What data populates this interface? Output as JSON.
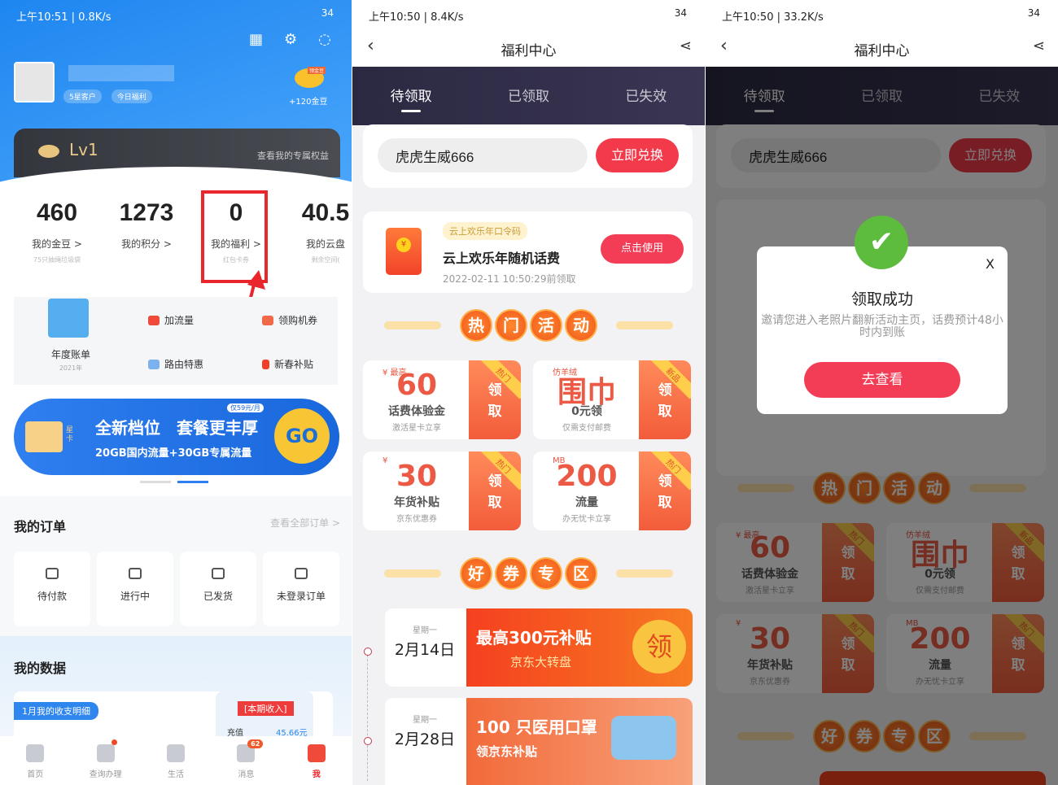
{
  "left": {
    "status": "上午10:51 | 0.8K/s",
    "battery": "34",
    "badges": [
      "5星客户",
      "今日福利"
    ],
    "beans_reward": "+120金豆",
    "beans_tag": "领金豆",
    "level": "Lv1",
    "level_link": "查看我的专属权益",
    "stats": [
      {
        "n": "460",
        "l": "我的金豆 >",
        "s": "75只抽绳垃圾袋"
      },
      {
        "n": "1273",
        "l": "我的积分 >",
        "s": ""
      },
      {
        "n": "0",
        "l": "我的福利 >",
        "s": "红包卡券"
      },
      {
        "n": "40.5",
        "l": "我的云盘",
        "s": "剩余空间("
      }
    ],
    "annual": {
      "label": "年度账单",
      "year": "2021年"
    },
    "quick": [
      "加流量",
      "领购机券",
      "路由特惠",
      "新春补贴"
    ],
    "banner": {
      "title": "全新档位　套餐更丰厚",
      "sub": "20GB国内流量+30GB专属流量",
      "tag": "仅59元/月",
      "go": "GO",
      "card": "星卡"
    },
    "orders": {
      "title": "我的订单",
      "link": "查看全部订单 >",
      "items": [
        "待付款",
        "进行中",
        "已发货",
        "未登录订单"
      ]
    },
    "data": {
      "title": "我的数据",
      "tag": "1月我的收支明细",
      "income": "[本期收入]",
      "row_label": "充值",
      "row_val": "45.66元"
    },
    "tabbar": [
      {
        "l": "首页"
      },
      {
        "l": "查询办理"
      },
      {
        "l": "生活"
      },
      {
        "l": "消息",
        "badge": "62"
      },
      {
        "l": "我"
      }
    ],
    "highlight_color": "#e8262b"
  },
  "mid": {
    "status": "上午10:50 | 8.4K/s",
    "battery": "34",
    "title": "福利中心",
    "tabs": [
      "待领取",
      "已领取",
      "已失效"
    ],
    "code_value": "虎虎生威666",
    "redeem": "立即兑换",
    "coupon": {
      "tag": "云上欢乐年口令码",
      "title": "云上欢乐年随机话费",
      "time": "2022-02-11 10:50:29前领取",
      "use": "点击使用"
    },
    "hot": [
      "热",
      "门",
      "活",
      "动"
    ],
    "acts": [
      {
        "sym": "¥ 最高",
        "big": "60",
        "sub": "话费体验金",
        "sm": "激活星卡立享",
        "rib": "热门"
      },
      {
        "sym": "仿羊绒",
        "big": "围巾",
        "sub": "0元领",
        "sm": "仅需支付邮费",
        "rib": "新品"
      },
      {
        "sym": "¥",
        "big": "30",
        "sub": "年货补贴",
        "sm": "京东优惠券",
        "rib": "热门"
      },
      {
        "sym": "MB",
        "big": "200",
        "sub": "流量",
        "sm": "办无忧卡立享",
        "rib": "热门"
      }
    ],
    "claim": "领 取",
    "good": [
      "好",
      "券",
      "专",
      "区"
    ],
    "entries": [
      {
        "wd": "星期一",
        "dt": "2月14日",
        "t1": "最高300元补贴",
        "t2": "京东大转盘",
        "coin": "领"
      },
      {
        "wd": "星期一",
        "dt": "2月28日",
        "t1": "100 只医用口罩",
        "t2": "领京东补贴",
        "coin": ""
      }
    ],
    "accent": "#f23a4b"
  },
  "right": {
    "status": "上午10:50 | 33.2K/s",
    "modal": {
      "title": "领取成功",
      "msg": "邀请您进入老照片翻新活动主页，话费预计48小时内到账",
      "btn": "去查看",
      "close": "X"
    }
  }
}
